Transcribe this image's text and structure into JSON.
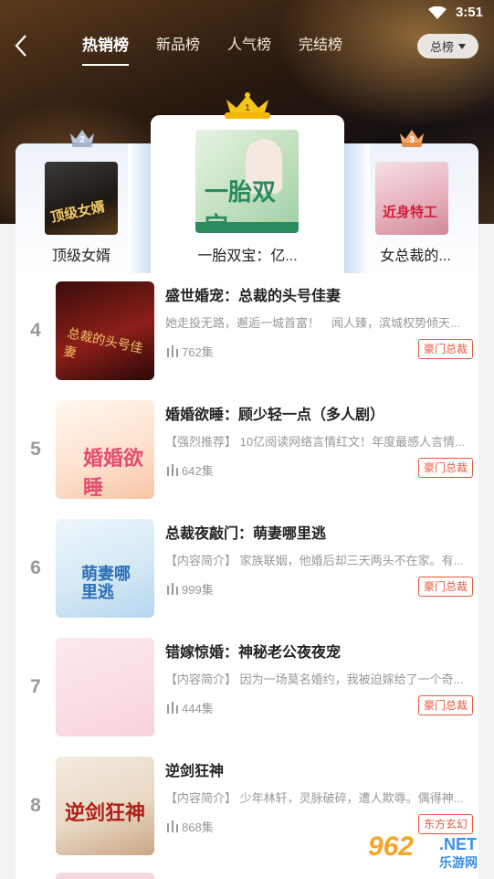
{
  "status": {
    "time": "3:51"
  },
  "header": {
    "tabs": [
      {
        "label": "热销榜",
        "active": true
      },
      {
        "label": "新品榜",
        "active": false
      },
      {
        "label": "人气榜",
        "active": false
      },
      {
        "label": "完结榜",
        "active": false
      }
    ],
    "dropdown": {
      "selected": "总榜"
    }
  },
  "podium": [
    {
      "rank": "2",
      "title": "顶级女婿",
      "cover_text": "顶级女婿",
      "crown_color": "#b8c6dc"
    },
    {
      "rank": "1",
      "title": "一胎双宝：亿...",
      "cover_text": "一胎双宝",
      "crown_color": "#f5c518"
    },
    {
      "rank": "3",
      "title": "女总裁的...",
      "cover_text": "近身特工",
      "crown_color": "#f0a56a"
    }
  ],
  "books": [
    {
      "rank": "4",
      "title": "盛世婚宠：总裁的头号佳妻",
      "tag": "",
      "desc": "她走投无路，邂逅一城首富！　闻人臻，滨城权势倾天...",
      "episodes": "762集",
      "genre": "豪门总裁",
      "cover_text": "总裁的头号佳妻"
    },
    {
      "rank": "5",
      "title": "婚婚欲睡：顾少轻一点（多人剧）",
      "tag": "【强烈推荐】",
      "desc": " 10亿阅读网络言情红文！年度最感人言情...",
      "episodes": "642集",
      "genre": "豪门总裁",
      "cover_text": "婚婚欲睡"
    },
    {
      "rank": "6",
      "title": "总裁夜敲门：萌妻哪里逃",
      "tag": "【内容简介】",
      "desc": " 家族联姻，他婚后却三天两头不在家。有...",
      "episodes": "999集",
      "genre": "豪门总裁",
      "cover_text": "萌妻哪里逃"
    },
    {
      "rank": "7",
      "title": "错嫁惊婚：神秘老公夜夜宠",
      "tag": "【内容简介】",
      "desc": " 因为一场莫名婚约，我被迫嫁给了一个奇...",
      "episodes": "444集",
      "genre": "豪门总裁",
      "cover_text": ""
    },
    {
      "rank": "8",
      "title": "逆剑狂神",
      "tag": "【内容简介】",
      "desc": " 少年林轩，灵脉破碎，遭人欺辱。偶得神...",
      "episodes": "868集",
      "genre": "东方玄幻",
      "cover_text": "逆剑狂神"
    }
  ],
  "watermark": {
    "number": "962",
    "domain": ".NET",
    "name": "乐游网"
  }
}
